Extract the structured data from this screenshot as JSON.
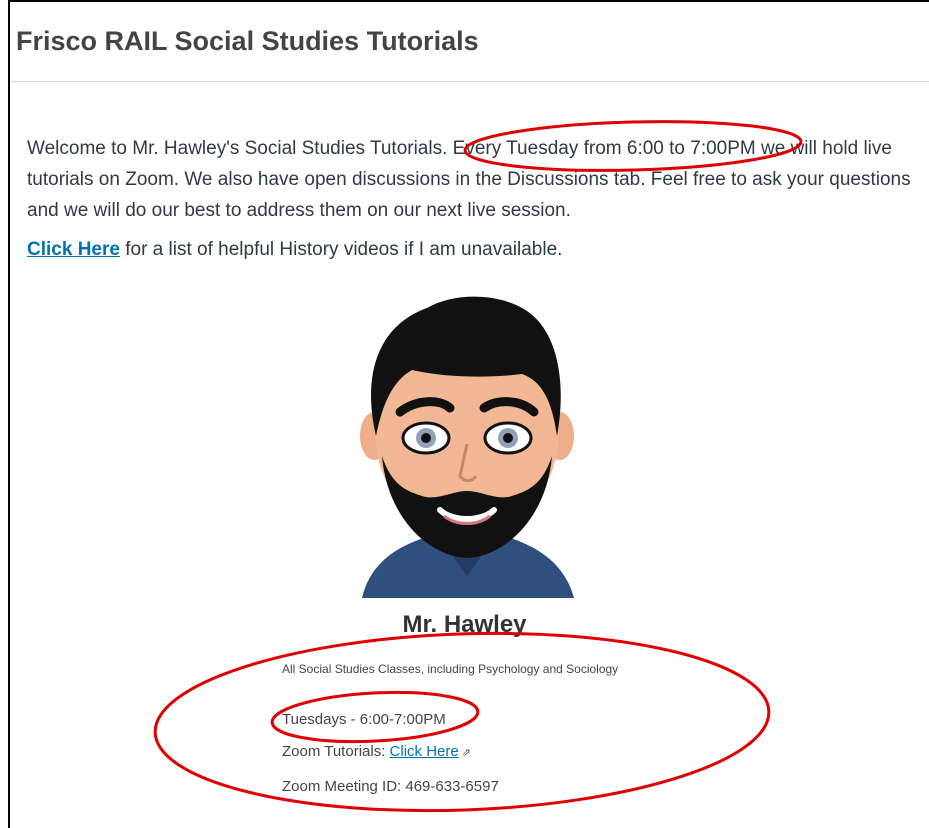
{
  "page": {
    "title": "Frisco RAIL Social Studies Tutorials"
  },
  "intro": {
    "text": "Welcome to Mr. Hawley's Social Studies Tutorials. Every Tuesday from 6:00 to 7:00PM we will hold live tutorials on Zoom. We also have open discussions in the Discussions tab. Feel free to ask your questions and we will do our best to address them on our next live session."
  },
  "videos": {
    "link_label": "Click Here",
    "after_text": " for a list of helpful History videos if I am unavailable."
  },
  "profile": {
    "name": "Mr. Hawley",
    "classes": "All Social Studies Classes, including Psychology and Sociology",
    "schedule": "Tuesdays - 6:00-7:00PM",
    "zoom_label": "Zoom Tutorials: ",
    "zoom_link": "Click Here",
    "meeting_id": "Zoom Meeting ID: 469-633-6597",
    "external_icon": "external-link-icon"
  },
  "annotation_color": "#e00000"
}
